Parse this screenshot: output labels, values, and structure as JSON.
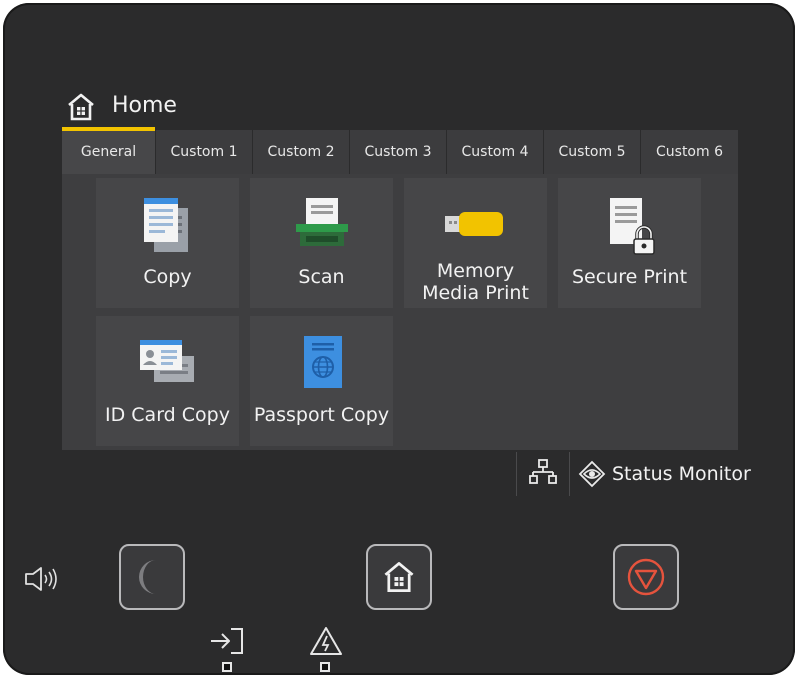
{
  "header": {
    "title": "Home"
  },
  "tabs": [
    {
      "label": "General",
      "active": true
    },
    {
      "label": "Custom 1",
      "active": false
    },
    {
      "label": "Custom 2",
      "active": false
    },
    {
      "label": "Custom 3",
      "active": false
    },
    {
      "label": "Custom 4",
      "active": false
    },
    {
      "label": "Custom 5",
      "active": false
    },
    {
      "label": "Custom 6",
      "active": false
    }
  ],
  "tiles": [
    {
      "line1": "Copy",
      "line2": "",
      "icon": "copy-icon"
    },
    {
      "line1": "Scan",
      "line2": "",
      "icon": "scan-icon"
    },
    {
      "line1": "Memory",
      "line2": "Media Print",
      "icon": "usb-memory-icon"
    },
    {
      "line1": "Secure Print",
      "line2": "",
      "icon": "secure-print-icon"
    },
    {
      "line1": "ID Card Copy",
      "line2": "",
      "icon": "id-card-icon"
    },
    {
      "line1": "Passport Copy",
      "line2": "",
      "icon": "passport-icon"
    }
  ],
  "statusbar": {
    "network_icon": "network-icon",
    "status_label": "Status Monitor"
  },
  "hardware": {
    "volume_icon": "speaker-icon",
    "sleep_icon": "moon-icon",
    "home_icon": "home-icon",
    "stop_icon": "stop-icon",
    "data_led_icon": "data-in-icon",
    "error_led_icon": "warning-icon"
  },
  "colors": {
    "accent": "#f2c300",
    "stop": "#e5533d",
    "screen": "#3e3e40",
    "body": "#2b2b2c"
  }
}
